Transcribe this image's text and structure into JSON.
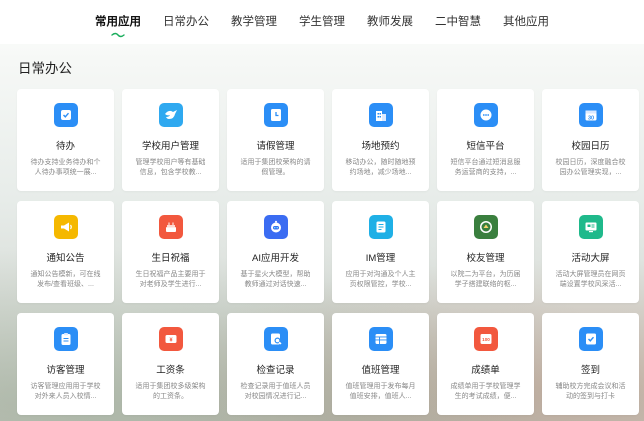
{
  "nav": {
    "tabs": [
      {
        "label": "常用应用",
        "active": true
      },
      {
        "label": "日常办公",
        "active": false
      },
      {
        "label": "教学管理",
        "active": false
      },
      {
        "label": "学生管理",
        "active": false
      },
      {
        "label": "教师发展",
        "active": false
      },
      {
        "label": "二中智慧",
        "active": false
      },
      {
        "label": "其他应用",
        "active": false
      }
    ]
  },
  "section": {
    "title": "日常办公"
  },
  "colors": {
    "accent": "#1aad5c",
    "blue": "#2b8ef6",
    "yellow": "#f5b800",
    "orange": "#f2583e",
    "teal": "#1fb98b"
  },
  "apps": [
    {
      "title": "待办",
      "desc": "待办支持业务待办和个人待办事项统一展...",
      "icon": "checkbox-icon",
      "color": "#2b8ef6"
    },
    {
      "title": "学校用户管理",
      "desc": "管理学校用户等有基础信息，包含学校教...",
      "icon": "bird-icon",
      "color": "#2fa9f0"
    },
    {
      "title": "请假管理",
      "desc": "适用于集团校荣构的请假管理。",
      "icon": "clock-doc-icon",
      "color": "#2b8ef6"
    },
    {
      "title": "场地预约",
      "desc": "移动办公，随时随地预约场地，减少场地...",
      "icon": "building-icon",
      "color": "#2b8ef6"
    },
    {
      "title": "短信平台",
      "desc": "短信平台通过短消息服务运营商的支持，...",
      "icon": "message-icon",
      "color": "#2b8ef6"
    },
    {
      "title": "校园日历",
      "desc": "校园日历，深度融合校园办公管理实现，...",
      "icon": "calendar-icon",
      "color": "#2b8ef6"
    },
    {
      "title": "通知公告",
      "desc": "通知公告模新，可在线发布/查看班级、...",
      "icon": "megaphone-icon",
      "color": "#f5b800"
    },
    {
      "title": "生日祝福",
      "desc": "生日祝福产品主要用于对老师及学生进行...",
      "icon": "cake-icon",
      "color": "#f2583e"
    },
    {
      "title": "AI应用开发",
      "desc": "基于星火大模型，帮助教师通过对话快速...",
      "icon": "robot-icon",
      "color": "#3b6cf2"
    },
    {
      "title": "IM管理",
      "desc": "应用于对沟通及个人主页权限管控，学校...",
      "icon": "doc-edit-icon",
      "color": "#1fb0e6"
    },
    {
      "title": "校友管理",
      "desc": "以院二为平台，为历届学子搭建联络的枢...",
      "icon": "school-emblem-icon",
      "color": "#3a7f3e"
    },
    {
      "title": "活动大屏",
      "desc": "活动大屏管理员在网页端设置学校风采活...",
      "icon": "screen-icon",
      "color": "#1fb98b"
    },
    {
      "title": "访客管理",
      "desc": "访客管理应用用于学校对外来人员入校情...",
      "icon": "clipboard-icon",
      "color": "#2b8ef6"
    },
    {
      "title": "工资条",
      "desc": "适用于集团校多级架构的工资条。",
      "icon": "ticket-icon",
      "color": "#f2583e"
    },
    {
      "title": "检查记录",
      "desc": "检查记录用于值班人员对校园情况进行记...",
      "icon": "inspect-icon",
      "color": "#2b8ef6"
    },
    {
      "title": "值班管理",
      "desc": "值班管理用于发布每月值班安排，值班人...",
      "icon": "table-icon",
      "color": "#2b8ef6"
    },
    {
      "title": "成绩单",
      "desc": "成绩单用于学校管理学生的考试成绩，便...",
      "icon": "score-100-icon",
      "color": "#f2583e"
    },
    {
      "title": "签到",
      "desc": "辅助校方完成会议和活动的签到与打卡",
      "icon": "signin-icon",
      "color": "#2b8ef6"
    }
  ]
}
